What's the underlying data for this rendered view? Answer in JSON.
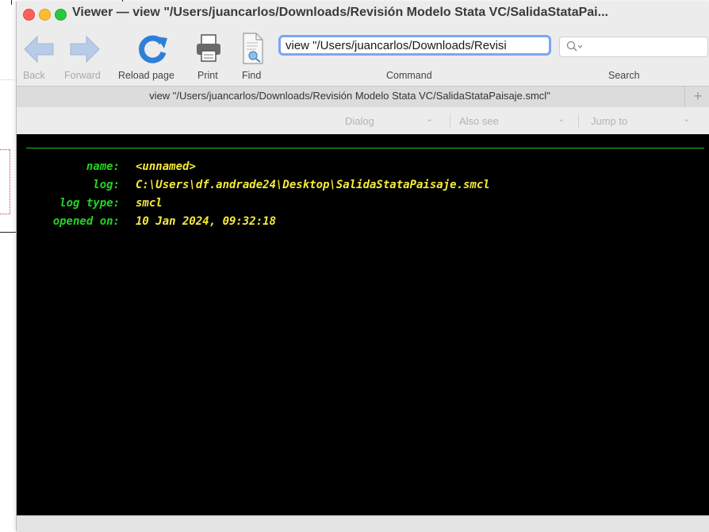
{
  "window": {
    "title": "Viewer — view \"/Users/juancarlos/Downloads/Revisión Modelo Stata VC/SalidaStataPai..."
  },
  "toolbar": {
    "back_label": "Back",
    "forward_label": "Forward",
    "reload_label": "Reload page",
    "print_label": "Print",
    "find_label": "Find",
    "command_label": "Command",
    "search_label": "Search",
    "command_value": "view \"/Users/juancarlos/Downloads/Revisi"
  },
  "tab": {
    "title": "view \"/Users/juancarlos/Downloads/Revisión Modelo Stata VC/SalidaStataPaisaje.smcl\"",
    "add_label": "+"
  },
  "navbar": {
    "dialog_label": "Dialog",
    "also_see_label": "Also see",
    "jump_to_label": "Jump to"
  },
  "log": {
    "rows": [
      {
        "key": "name:",
        "value": "<unnamed>"
      },
      {
        "key": "log:",
        "value": "C:\\Users\\df.andrade24\\Desktop\\SalidaStataPaisaje.smcl"
      },
      {
        "key": "log type:",
        "value": "smcl"
      },
      {
        "key": "opened on:",
        "value": "10 Jan 2024, 09:32:18"
      }
    ]
  },
  "colors": {
    "key_green": "#22d422",
    "value_yellow": "#f5ec3a",
    "background": "#000000",
    "accent_blue": "#7aa6f5"
  }
}
